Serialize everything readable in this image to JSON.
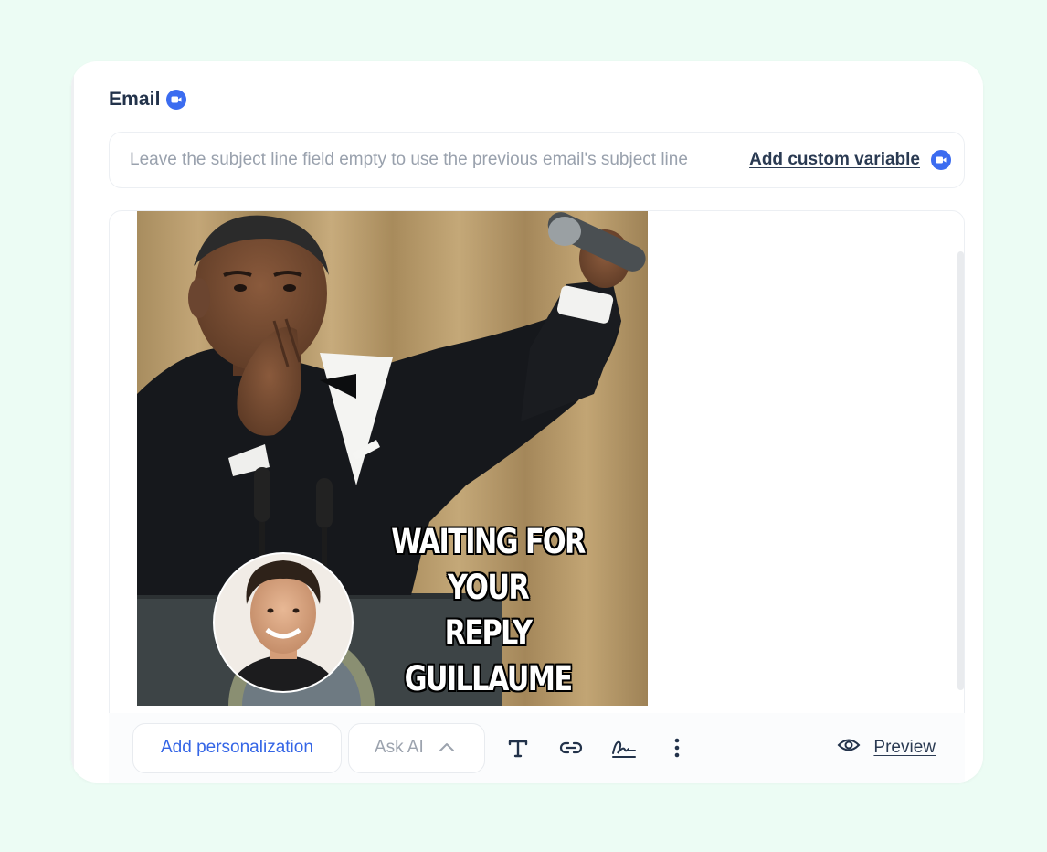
{
  "section": {
    "title": "Email",
    "title_icon": "video-camera-icon"
  },
  "subject": {
    "placeholder": "Leave the subject line field empty to use the previous email's subject line",
    "value": "",
    "add_variable_label": "Add custom variable",
    "add_variable_icon": "video-camera-icon"
  },
  "editor": {
    "image": {
      "caption_line1": "WAITING FOR YOUR",
      "caption_line2": "REPLY GUILLAUME"
    }
  },
  "toolbar": {
    "personalization_label": "Add personalization",
    "ask_ai_label": "Ask AI",
    "icons": [
      "chevron-up-icon",
      "text-format-icon",
      "link-icon",
      "signature-icon",
      "more-vertical-icon",
      "eye-icon"
    ],
    "preview_label": "Preview"
  },
  "colors": {
    "background": "#ecfcf4",
    "accent": "#3b6cf0",
    "text_dark": "#22324a",
    "muted": "#99a1ad"
  }
}
